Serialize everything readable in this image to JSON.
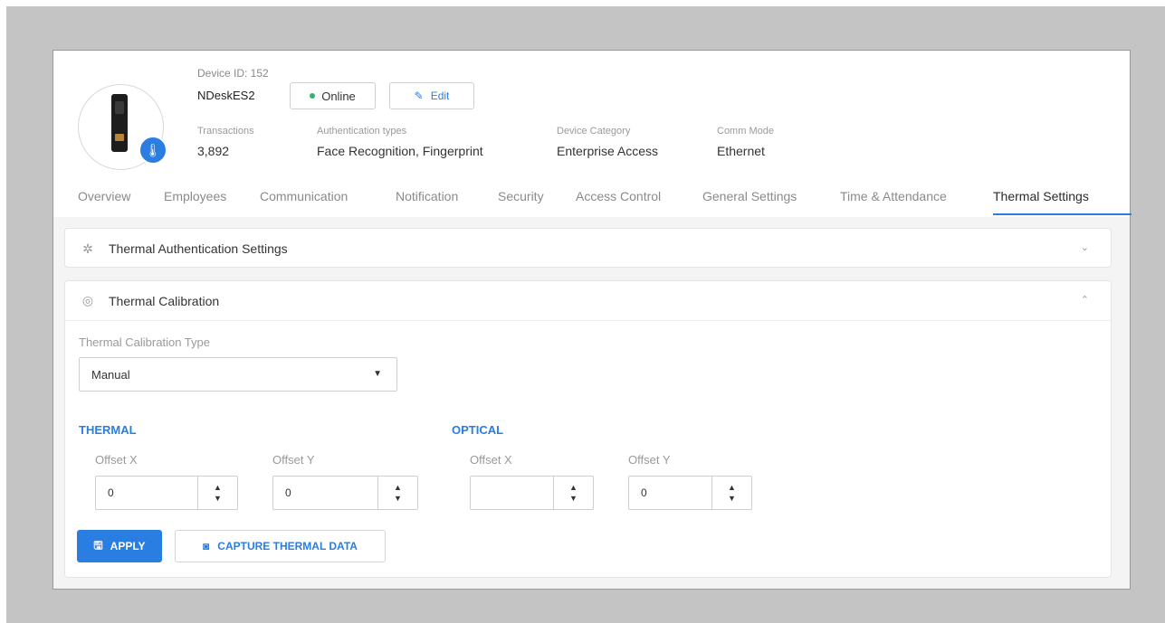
{
  "device": {
    "id_label": "Device ID: 152",
    "name": "NDeskES2",
    "status": "Online",
    "status_color": "#2fb36a",
    "edit_label": "Edit",
    "meta": [
      {
        "label": "Transactions",
        "value": "3,892"
      },
      {
        "label": "Authentication types",
        "value": "Face Recognition, Fingerprint"
      },
      {
        "label": "Device Category",
        "value": "Enterprise Access"
      },
      {
        "label": "Comm Mode",
        "value": "Ethernet"
      }
    ]
  },
  "tabs": [
    {
      "label": "Overview"
    },
    {
      "label": "Employees"
    },
    {
      "label": "Communication"
    },
    {
      "label": "Notification"
    },
    {
      "label": "Security"
    },
    {
      "label": "Access Control"
    },
    {
      "label": "General Settings"
    },
    {
      "label": "Time & Attendance"
    },
    {
      "label": "Thermal Settings",
      "active": true
    }
  ],
  "panels": {
    "auth": {
      "title": "Thermal Authentication Settings",
      "icon": "thermometer-icon",
      "expanded": false
    },
    "calibration": {
      "title": "Thermal Calibration",
      "icon": "calibration-icon",
      "expanded": true,
      "type_label": "Thermal Calibration Type",
      "type_value": "Manual",
      "thermal": {
        "title": "THERMAL",
        "offset_x_label": "Offset X",
        "offset_x": "0",
        "offset_y_label": "Offset Y",
        "offset_y": "0"
      },
      "optical": {
        "title": "OPTICAL",
        "offset_x_label": "Offset X",
        "offset_x": "",
        "offset_y_label": "Offset Y",
        "offset_y": "0"
      },
      "apply_label": "APPLY",
      "capture_label": "CAPTURE THERMAL DATA"
    }
  },
  "colors": {
    "accent": "#2a7de1",
    "frame": "#c4c4c4"
  }
}
